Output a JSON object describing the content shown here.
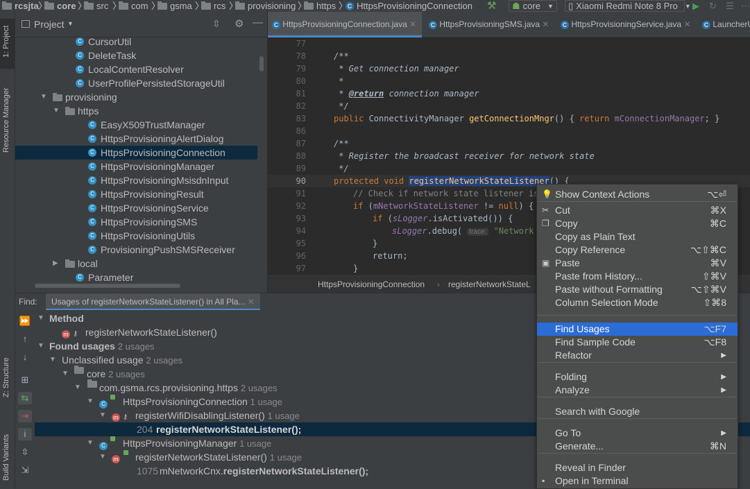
{
  "topbar": {
    "crumbs": [
      "rcsjta",
      "core",
      "src",
      "com",
      "gsma",
      "rcs",
      "provisioning",
      "https",
      "HttpsProvisioningConnection"
    ],
    "module": "core",
    "device": "Xiaomi Redmi Note 8 Pro"
  },
  "left_strip": {
    "project_tab": "1: Project",
    "resource_tab": "Resource Manager",
    "structure_tab": "Z: Structure",
    "build_tab": "Build Variants"
  },
  "project_panel": {
    "title": "Project",
    "items": [
      {
        "label": "CursorUtil",
        "type": "class"
      },
      {
        "label": "DeleteTask",
        "type": "class"
      },
      {
        "label": "LocalContentResolver",
        "type": "class"
      },
      {
        "label": "UserProfilePersistedStorageUtil",
        "type": "class"
      },
      {
        "label": "provisioning",
        "type": "package"
      },
      {
        "label": "https",
        "type": "package"
      },
      {
        "label": "EasyX509TrustManager",
        "type": "class"
      },
      {
        "label": "HttpsProvisioningAlertDialog",
        "type": "class"
      },
      {
        "label": "HttpsProvisioningConnection",
        "type": "class"
      },
      {
        "label": "HttpsProvisioningManager",
        "type": "class"
      },
      {
        "label": "HttpsProvisioningMsisdnInput",
        "type": "class"
      },
      {
        "label": "HttpsProvisioningResult",
        "type": "class"
      },
      {
        "label": "HttpsProvisioningService",
        "type": "class"
      },
      {
        "label": "HttpsProvisioningSMS",
        "type": "class"
      },
      {
        "label": "HttpsProvisioningUtils",
        "type": "class"
      },
      {
        "label": "ProvisioningPushSMSReceiver",
        "type": "class"
      },
      {
        "label": "local",
        "type": "package"
      },
      {
        "label": "Parameter",
        "type": "class"
      }
    ]
  },
  "editor": {
    "tabs": [
      "HttpsProvisioningConnection.java",
      "HttpsProvisioningSMS.java",
      "HttpsProvisioningService.java",
      "LauncherU"
    ],
    "line_numbers": [
      "77",
      "78",
      "79",
      "80",
      "81",
      "82",
      "83",
      "86",
      "87",
      "88",
      "89",
      "90",
      "91",
      "92",
      "93",
      "94",
      "95",
      "96",
      "97"
    ],
    "code": {
      "l78": "/**",
      "l79": " * Get connection manager",
      "l80": " *",
      "l81_tag": "@return",
      "l81_rest": " connection manager",
      "l82": " */",
      "l83_kw": "public",
      "l83_type": " ConnectivityManager ",
      "l83_fn": "getConnectionMngr",
      "l83_mid": "() { ",
      "l83_ret": "return",
      "l83_fld": " mConnectionManager",
      "l83_end": "; }",
      "l87": "/**",
      "l88": " * Register the broadcast receiver for network state",
      "l89": " */",
      "l90_kw": "protected void ",
      "l90_fn": "registerNetworkStateListener",
      "l90_end": "() {",
      "l91": "// Check if network state listener is",
      "l92_kw": "if",
      "l92_a": " (",
      "l92_fld": "mNetworkStateListener",
      "l92_b": " != ",
      "l92_null": "null",
      "l92_c": ") {",
      "l93_kw": "if",
      "l93_a": " (",
      "l93_fld": "sLogger",
      "l93_b": ".isActivated()) {",
      "l94_fld": "sLogger",
      "l94_a": ".debug( ",
      "l94_hint": "trace:",
      "l94_str": " \"Network s",
      "l95": "}",
      "l96": "return;",
      "l97": "}"
    },
    "breadcrumbs": [
      "HttpsProvisioningConnection",
      "registerNetworkStateL"
    ]
  },
  "find": {
    "label": "Find:",
    "tab": "Usages of registerNetworkStateListener() in All Pla...",
    "rows": [
      {
        "text": "Method",
        "count": ""
      },
      {
        "text": "registerNetworkStateListener()",
        "count": ""
      },
      {
        "text": "Found usages",
        "count": "2 usages"
      },
      {
        "text": "Unclassified usage",
        "count": "2 usages"
      },
      {
        "text": "core",
        "count": "2 usages"
      },
      {
        "text": "com.gsma.rcs.provisioning.https",
        "count": "2 usages"
      },
      {
        "text": "HttpsProvisioningConnection",
        "count": "1 usage"
      },
      {
        "text": "registerWifiDisablingListener()",
        "count": "1 usage"
      },
      {
        "line": "204",
        "text": "registerNetworkStateListener();"
      },
      {
        "text": "HttpsProvisioningManager",
        "count": "1 usage"
      },
      {
        "text": "registerNetworkStateListener()",
        "count": "1 usage"
      },
      {
        "line": "1075",
        "prefix": "mNetworkCnx.",
        "text": "registerNetworkStateListener();"
      }
    ]
  },
  "context_menu": {
    "items": [
      {
        "label": "Show Context Actions",
        "shortcut": "⌥⏎",
        "icon": "bulb-icon"
      },
      {
        "label": "Cut",
        "shortcut": "⌘X",
        "icon": "scissors-icon"
      },
      {
        "label": "Copy",
        "shortcut": "⌘C",
        "icon": "copy-icon"
      },
      {
        "label": "Copy as Plain Text",
        "shortcut": ""
      },
      {
        "label": "Copy Reference",
        "shortcut": "⌥⇧⌘C"
      },
      {
        "label": "Paste",
        "shortcut": "⌘V",
        "icon": "clipboard-icon"
      },
      {
        "label": "Paste from History...",
        "shortcut": "⇧⌘V"
      },
      {
        "label": "Paste without Formatting",
        "shortcut": "⌥⇧⌘V"
      },
      {
        "label": "Column Selection Mode",
        "shortcut": "⇧⌘8"
      },
      {
        "label": "Find Usages",
        "shortcut": "⌥F7"
      },
      {
        "label": "Find Sample Code",
        "shortcut": "⌥F8"
      },
      {
        "label": "Refactor",
        "shortcut": "▶"
      },
      {
        "label": "Folding",
        "shortcut": "▶"
      },
      {
        "label": "Analyze",
        "shortcut": "▶"
      },
      {
        "label": "Search with Google",
        "shortcut": ""
      },
      {
        "label": "Go To",
        "shortcut": "▶"
      },
      {
        "label": "Generate...",
        "shortcut": "⌘N"
      },
      {
        "label": "Reveal in Finder",
        "shortcut": ""
      },
      {
        "label": "Open in Terminal",
        "shortcut": "",
        "icon": "terminal-icon"
      }
    ],
    "highlighted": "Find Usages",
    "highlight_color": "#2c6cd6"
  }
}
